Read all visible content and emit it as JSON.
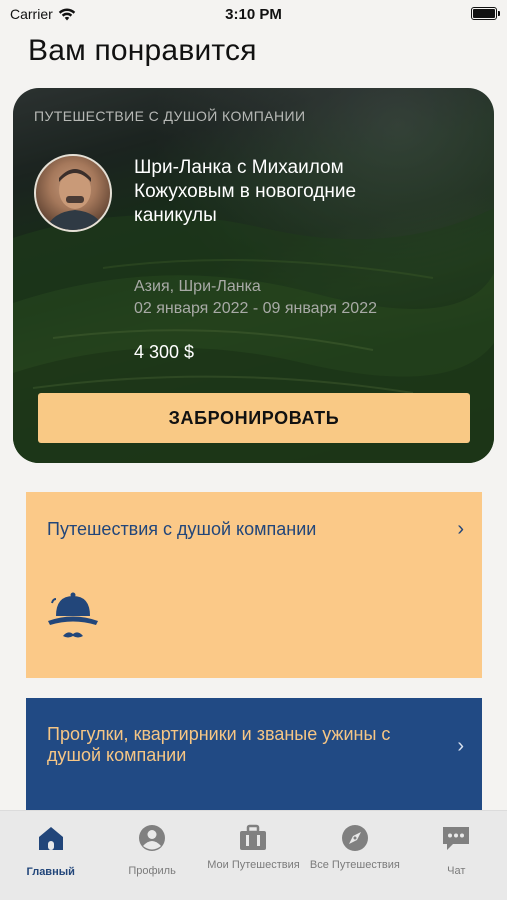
{
  "status_bar": {
    "carrier": "Carrier",
    "time": "3:10 PM"
  },
  "page": {
    "title": "Вам понравится"
  },
  "featured": {
    "category": "Путешествие с душой компании",
    "title": "Шри-Ланка с Михаилом Кожуховым в новогодние каникулы",
    "location": "Азия, Шри-Ланка",
    "dates": "02 января 2022 - 09 января 2022",
    "price": "4 300 $",
    "book_label": "ЗАБРОНИРОВАТЬ"
  },
  "categories": [
    {
      "label": "Путешествия с душой компании",
      "icon": "pith-helmet-mustache-icon",
      "color": "#fbc988"
    },
    {
      "label": "Прогулки, квартирники и званые ужины с душой компании",
      "color": "#214a84"
    }
  ],
  "tab_bar": {
    "active_color": "#22467a",
    "tabs": [
      {
        "label": "Главный",
        "icon": "home-icon",
        "active": true
      },
      {
        "label": "Профиль",
        "icon": "profile-icon"
      },
      {
        "label": "Мои Путешествия",
        "icon": "briefcase-icon"
      },
      {
        "label": "Все Путешествия",
        "icon": "compass-icon"
      },
      {
        "label": "Чат",
        "icon": "chat-icon"
      }
    ]
  }
}
